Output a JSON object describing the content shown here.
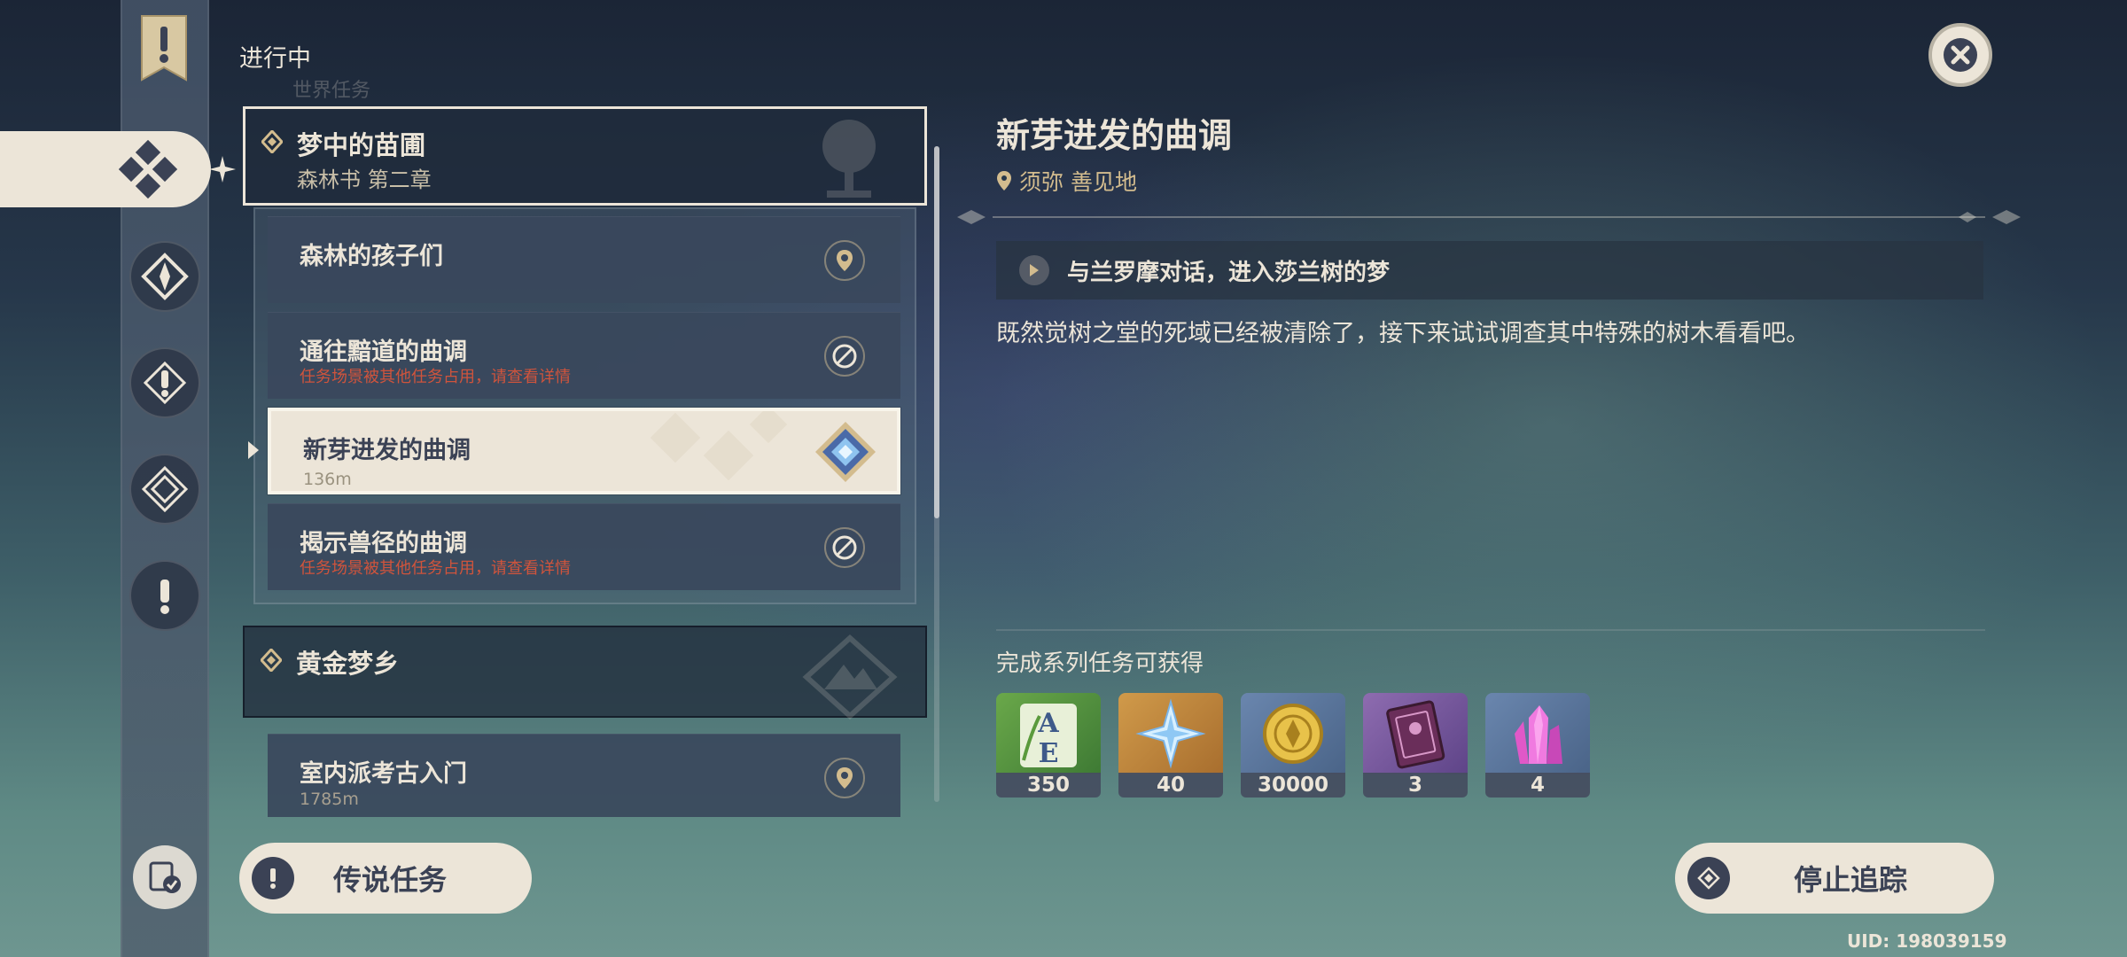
{
  "header": {
    "section_label": "进行中",
    "faded_label": "世界任务"
  },
  "rail": {
    "icons": [
      "quest-banner-icon",
      "all-quests-icon",
      "archon-quest-icon",
      "story-quest-icon",
      "world-quest-icon",
      "legend-quest-icon",
      "commission-icon",
      "quest-history-icon"
    ]
  },
  "quest_list": {
    "series": [
      {
        "title": "梦中的苗圃",
        "subtitle": "森林书 第二章"
      },
      {
        "title": "黄金梦乡",
        "subtitle": ""
      }
    ],
    "quests": [
      {
        "title": "森林的孩子们",
        "status": "",
        "icon": "location-pin-icon"
      },
      {
        "title": "通往黯道的曲调",
        "status": "任务场景被其他任务占用，请查看详情",
        "icon": "blocked-icon"
      },
      {
        "title": "新芽进发的曲调",
        "status": "136m",
        "icon": "tracking-diamond-icon"
      },
      {
        "title": "揭示兽径的曲调",
        "status": "任务场景被其他任务占用，请查看详情",
        "icon": "blocked-icon"
      },
      {
        "title": "室内派考古入门",
        "status": "1785m",
        "icon": "location-pin-icon"
      }
    ]
  },
  "detail": {
    "title": "新芽进发的曲调",
    "location": "须弥 善见地",
    "objective": "与兰罗摩对话，进入莎兰树的梦",
    "description": "既然觉树之堂的死域已经被清除了，接下来试试调查其中特殊的树木看看吧。"
  },
  "rewards": {
    "label": "完成系列任务可获得",
    "items": [
      {
        "name": "adventure-exp-icon",
        "count": "350",
        "color": "#5a9a3c"
      },
      {
        "name": "primogem-icon",
        "count": "40",
        "color": "#b8843c"
      },
      {
        "name": "mora-icon",
        "count": "30000",
        "color": "#5a7396"
      },
      {
        "name": "talent-book-icon",
        "count": "3",
        "color": "#7a5a9a"
      },
      {
        "name": "crystal-icon",
        "count": "4",
        "color": "#5a7396"
      }
    ]
  },
  "buttons": {
    "legend": "传说任务",
    "stop": "停止追踪"
  },
  "uid": "UID: 198039159",
  "colors": {
    "cream": "#ece5d8",
    "dark_text": "#3b4255",
    "gold": "#d3bc8e",
    "warning": "#d0543c"
  }
}
